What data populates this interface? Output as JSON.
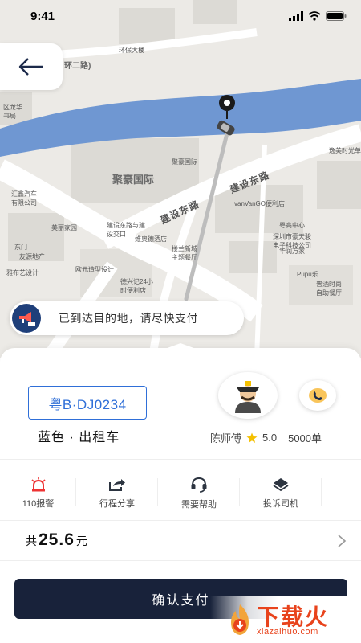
{
  "status": {
    "time": "9:41"
  },
  "map": {
    "labels": {
      "huanbao": "环保大楼",
      "ring2": "环二路)",
      "juhao_guoji_big": "聚豪国际",
      "juhao_guoji_small": "聚豪国际",
      "jianshe_dong_1": "建设东路",
      "jianshe_dong_2": "建设东路",
      "yimei": "逸美时光单",
      "vanvango": "vanVanGO便利店",
      "yuegao": "粤高中心",
      "shenzhen_jiaxing": "深圳市豪天骏\n电子科技公司",
      "huarun": "华润万家",
      "pupu": "Pupu乐",
      "pushi": "普洒时尚\n自助餐厅",
      "huizhi": "汇鑫汽车\n有限公司",
      "meili": "美丽家园",
      "jianshe_shop": "建设东路与建\n设交口",
      "weiaode": "维奥德酒店",
      "dongmen": "东门",
      "youyuan": "友源地产",
      "yayi": "雅布艺设计",
      "ouyuan": "欧元造型设计",
      "desheng": "德兴记24小\n时便利店",
      "loulan": "楼兰新城\n主题餐厅",
      "longhua": "区龙华\n书局"
    }
  },
  "notice": {
    "text": "已到达目的地，请尽快支付"
  },
  "vehicle": {
    "plate": "粤B·DJ0234",
    "description": "蓝色 · 出租车"
  },
  "driver": {
    "name": "陈师傅",
    "rating": "5.0",
    "orders": "5000单"
  },
  "actions": [
    {
      "label": "110报警",
      "icon": "alarm-icon"
    },
    {
      "label": "行程分享",
      "icon": "share-icon"
    },
    {
      "label": "需要帮助",
      "icon": "headset-icon"
    },
    {
      "label": "投诉司机",
      "icon": "complaint-icon"
    }
  ],
  "fare": {
    "prefix": "共",
    "amount": "25.6",
    "unit": "元"
  },
  "pay_button": {
    "label": "确认支付"
  },
  "watermark": {
    "text": "下载火",
    "url": "xiazaihuo.com"
  },
  "colors": {
    "primary_dark": "#18223a",
    "plate_blue": "#2f6fd8",
    "river": "#6f97d2",
    "star": "#f4c000",
    "watermark": "#e8431c"
  }
}
